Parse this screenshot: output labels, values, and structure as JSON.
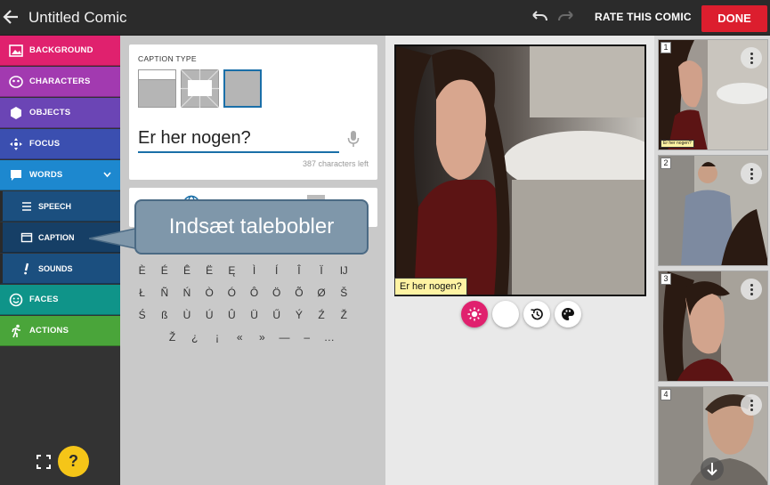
{
  "header": {
    "title": "Untitled Comic",
    "rate_label": "RATE THIS COMIC",
    "done_label": "DONE"
  },
  "sidebar": {
    "items": [
      {
        "label": "BACKGROUND",
        "icon": "image-icon",
        "color": "#e0216e"
      },
      {
        "label": "CHARACTERS",
        "icon": "face-mask-icon",
        "color": "#a23ab0"
      },
      {
        "label": "OBJECTS",
        "icon": "hexagon-icon",
        "color": "#6b45b5"
      },
      {
        "label": "FOCUS",
        "icon": "move-icon",
        "color": "#3b4fb0"
      },
      {
        "label": "WORDS",
        "icon": "speech-icon",
        "color": "#1d88cf"
      },
      {
        "label": "FACES",
        "icon": "smiley-icon",
        "color": "#0f9489"
      },
      {
        "label": "ACTIONS",
        "icon": "running-icon",
        "color": "#4aa53a"
      }
    ],
    "sub_items": [
      {
        "label": "SPEECH",
        "icon": "list-icon"
      },
      {
        "label": "CAPTION",
        "icon": "caption-icon"
      },
      {
        "label": "SOUNDS",
        "icon": "exclamation-icon"
      }
    ],
    "help_label": "?"
  },
  "caption_editor": {
    "type_label": "CAPTION TYPE",
    "text_value": "Er her nogen?",
    "chars_left": "387 characters left",
    "special_chars": [
      [
        "È",
        "É",
        "Ê",
        "Ë",
        "Ę",
        "Ì",
        "Í",
        "Î",
        "Ï",
        "Ĳ"
      ],
      [
        "Ł",
        "Ñ",
        "Ń",
        "Ò",
        "Ó",
        "Ô",
        "Ö",
        "Õ",
        "Ø",
        "Š"
      ],
      [
        "Ś",
        "ß",
        "Ù",
        "Ú",
        "Û",
        "Ü",
        "Ű",
        "Ý",
        "Ź",
        "Ž"
      ],
      [
        "Ž",
        "¿",
        "¡",
        "«",
        "»",
        "—",
        "–",
        "…"
      ]
    ]
  },
  "tooltip": {
    "text": "Indsæt talebobler"
  },
  "canvas": {
    "caption_text": "Er her nogen?",
    "tools": [
      "brightness-icon",
      "moon-icon",
      "history-icon",
      "palette-icon"
    ]
  },
  "strip": {
    "panels": [
      {
        "number": "1",
        "caption": "Er her nogen?"
      },
      {
        "number": "2"
      },
      {
        "number": "3"
      },
      {
        "number": "4"
      }
    ]
  },
  "colors": {
    "accent": "#dc1e2e",
    "words_active": "#1d88cf",
    "sub_bg": "#1b4f7f",
    "caption_fill": "#fff3a3",
    "tool_active": "#e0216e"
  }
}
